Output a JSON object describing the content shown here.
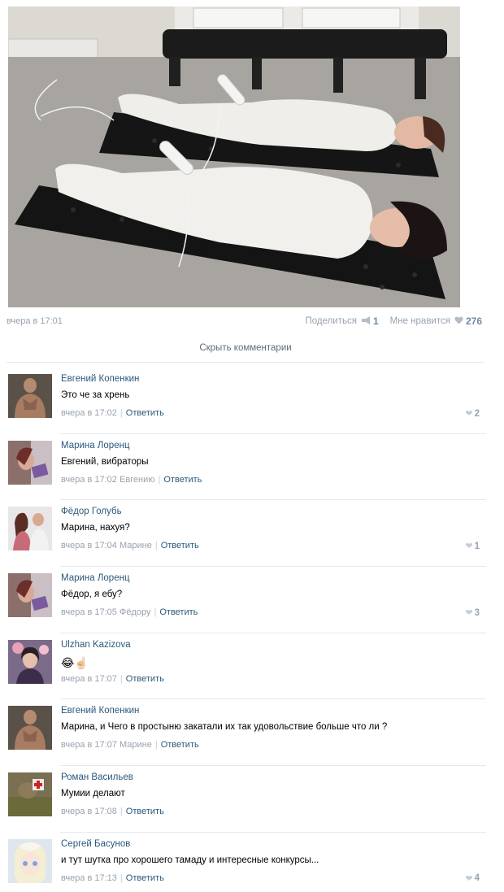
{
  "post": {
    "time": "вчера в 17:01",
    "share_label": "Поделиться",
    "share_count": "1",
    "like_label": "Мне нравится",
    "like_count": "276",
    "share_icon": "megaphone-icon",
    "like_icon": "heart-icon"
  },
  "hide_comments_label": "Скрыть комментарии",
  "reply_label": "Ответить",
  "comments": [
    {
      "author": "Евгений Копенкин",
      "text": "Это че за хрень",
      "time": "вчера в 17:02",
      "to": "",
      "likes": "2"
    },
    {
      "author": "Марина Лоренц",
      "text": "Евгений, вибраторы",
      "time": "вчера в 17:02",
      "to": "Евгению",
      "likes": ""
    },
    {
      "author": "Фёдор Голубь",
      "text": "Марина, нахуя?",
      "time": "вчера в 17:04",
      "to": "Марине",
      "likes": "1"
    },
    {
      "author": "Марина Лоренц",
      "text": "Фёдор, я ебу?",
      "time": "вчера в 17:05",
      "to": "Фёдору",
      "likes": "3"
    },
    {
      "author": "Ulzhan Kazizova",
      "text": "😂☝🏻",
      "time": "вчера в 17:07",
      "to": "",
      "likes": ""
    },
    {
      "author": "Евгений Копенкин",
      "text": "Марина, и Чего в простыню закатали их так удовольствие больше что ли ?",
      "time": "вчера в 17:07",
      "to": "Марине",
      "likes": ""
    },
    {
      "author": "Роман Васильев",
      "text": "Мумии делают",
      "time": "вчера в 17:08",
      "to": "",
      "likes": ""
    },
    {
      "author": "Сергей Басунов",
      "text": "и тут шутка про хорошего тамаду и интересные конкурсы...",
      "time": "вчера в 17:13",
      "to": "",
      "likes": "4"
    }
  ]
}
